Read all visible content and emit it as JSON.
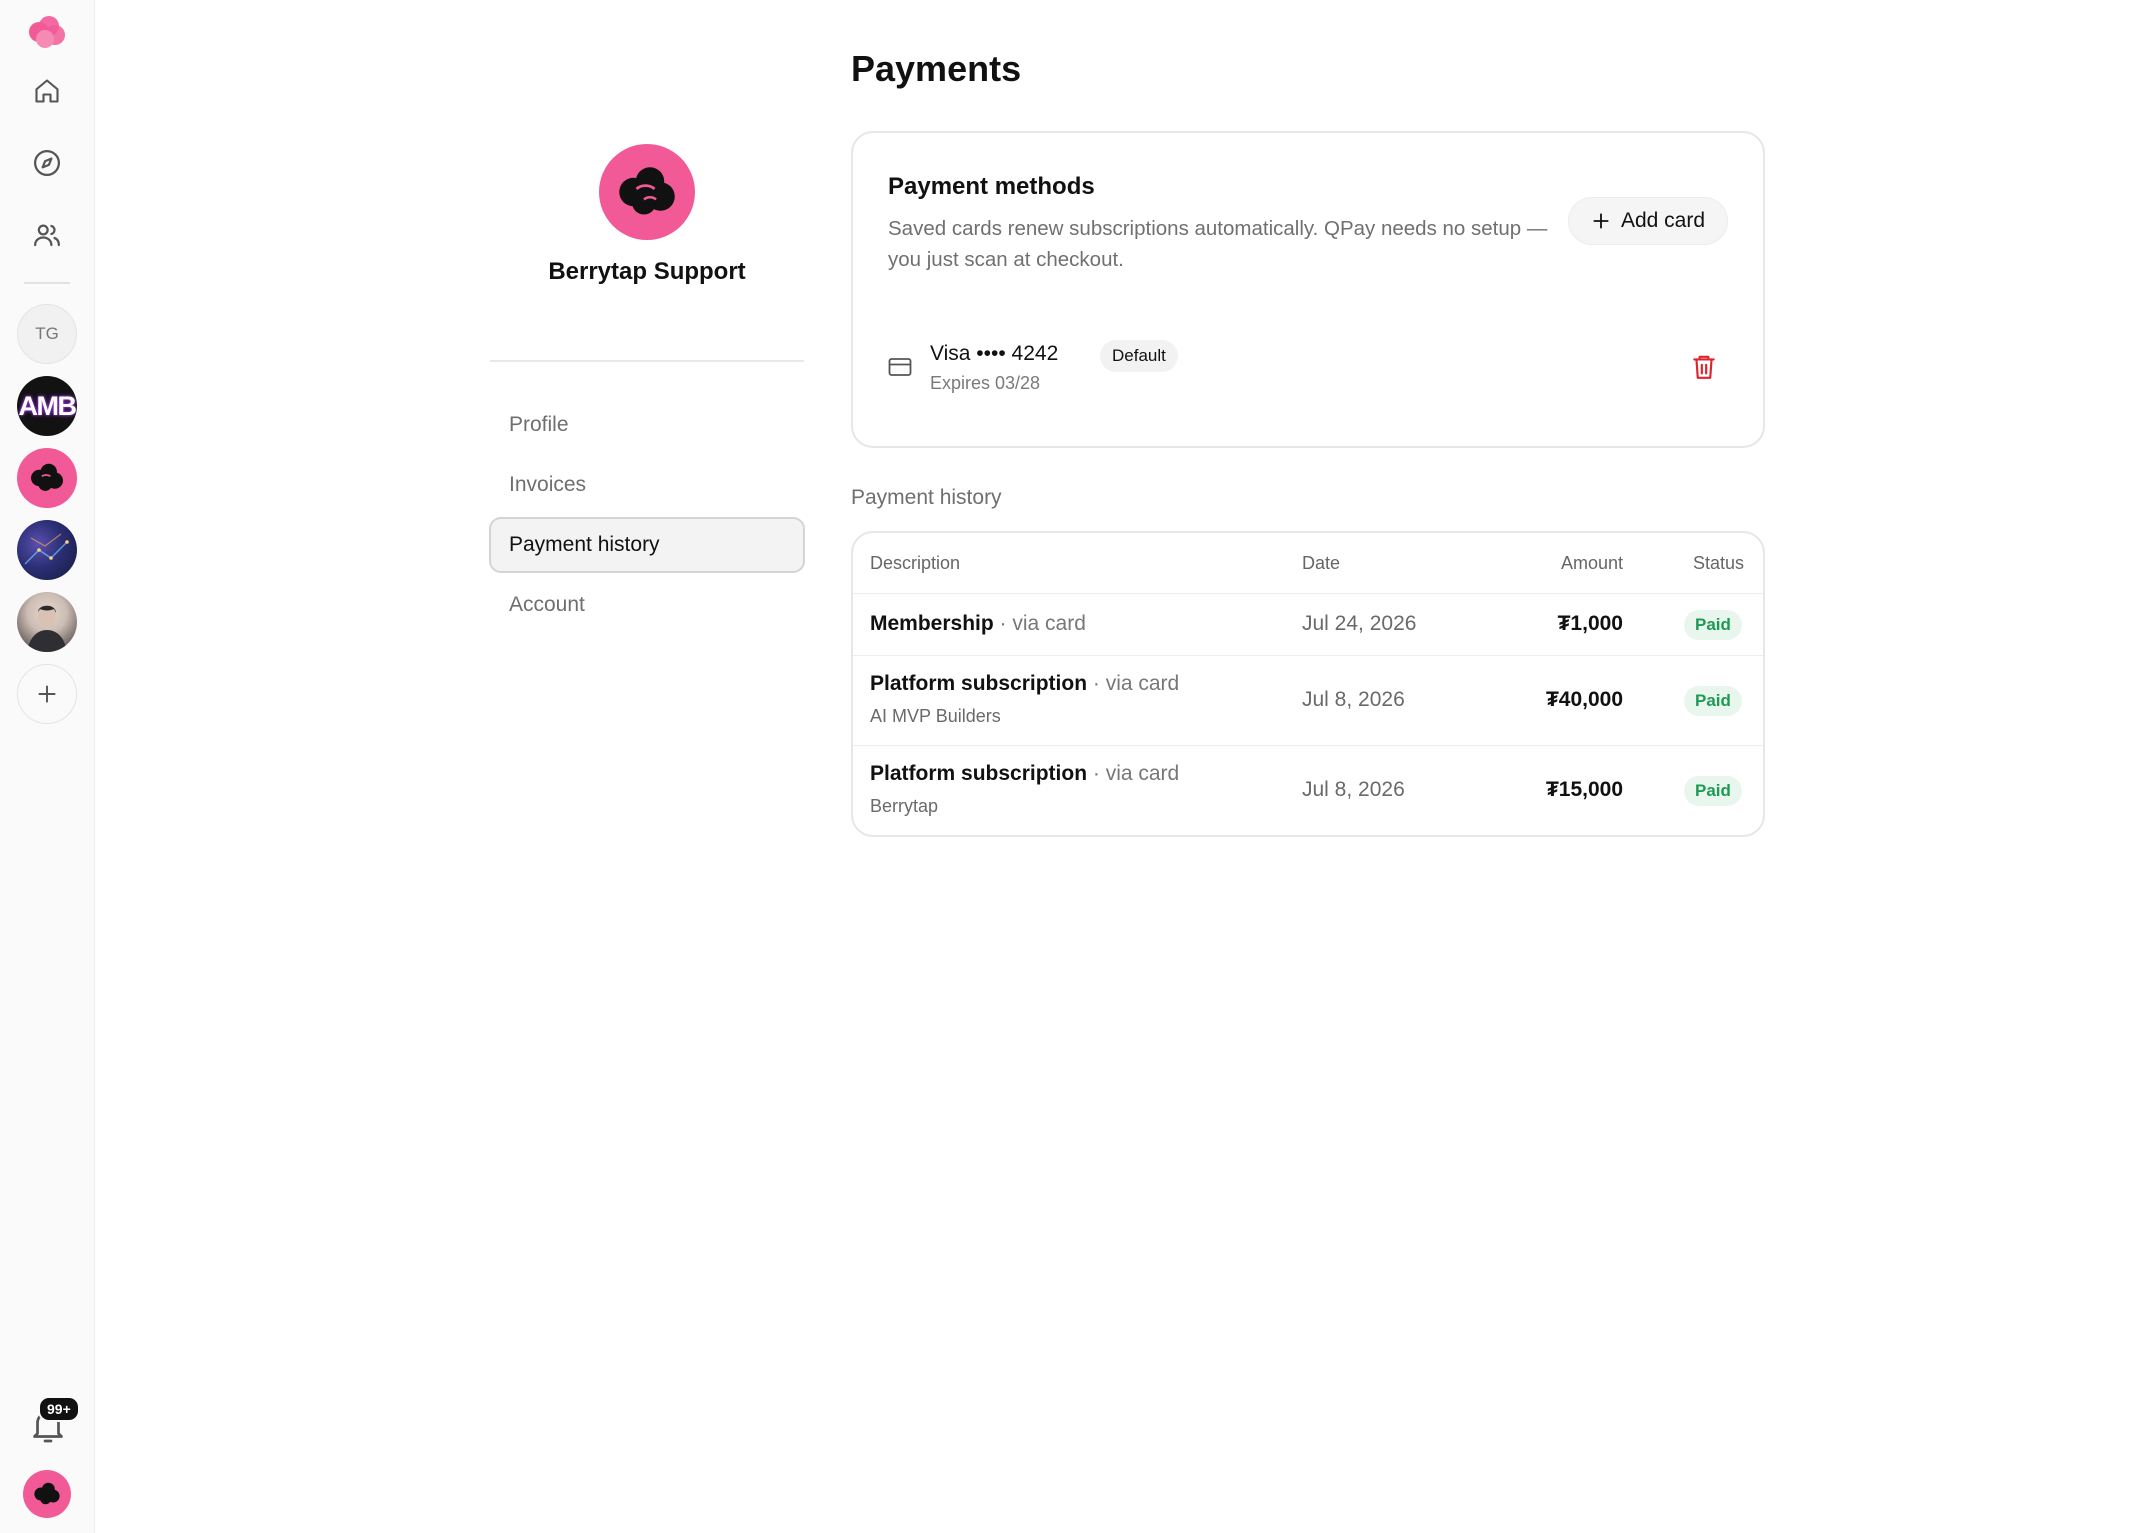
{
  "rail": {
    "items": [
      {
        "name": "home"
      },
      {
        "name": "explore"
      },
      {
        "name": "people"
      }
    ],
    "workspaces": [
      {
        "initials": "TG"
      },
      {
        "initials": "AMB"
      }
    ],
    "notifications_badge": "99+"
  },
  "org": {
    "name": "Berrytap Support"
  },
  "nav": {
    "items": [
      "Profile",
      "Invoices",
      "Payment history",
      "Account"
    ],
    "active": "Payment history"
  },
  "page": {
    "title": "Payments"
  },
  "payment_methods": {
    "title": "Payment methods",
    "description": "Saved cards renew subscriptions automatically. QPay needs no setup — you just scan at checkout.",
    "add_button": "Add card",
    "card": {
      "label": "Visa •••• 4242",
      "badge": "Default",
      "expires": "Expires 03/28"
    }
  },
  "history": {
    "title": "Payment history",
    "columns": [
      "Description",
      "Date",
      "Amount",
      "Status"
    ],
    "rows": [
      {
        "title": "Membership",
        "via": "· via card",
        "sub": "",
        "date": "Jul 24, 2026",
        "amount": "₮1,000",
        "status": "Paid"
      },
      {
        "title": "Platform subscription",
        "via": "· via card",
        "sub": "AI MVP Builders",
        "date": "Jul 8, 2026",
        "amount": "₮40,000",
        "status": "Paid"
      },
      {
        "title": "Platform subscription",
        "via": "· via card",
        "sub": "Berrytap",
        "date": "Jul 8, 2026",
        "amount": "₮15,000",
        "status": "Paid"
      }
    ]
  },
  "colors": {
    "brand_pink": "#f15a97",
    "paid_green": "#1f9a55",
    "danger_red": "#e0242f"
  }
}
